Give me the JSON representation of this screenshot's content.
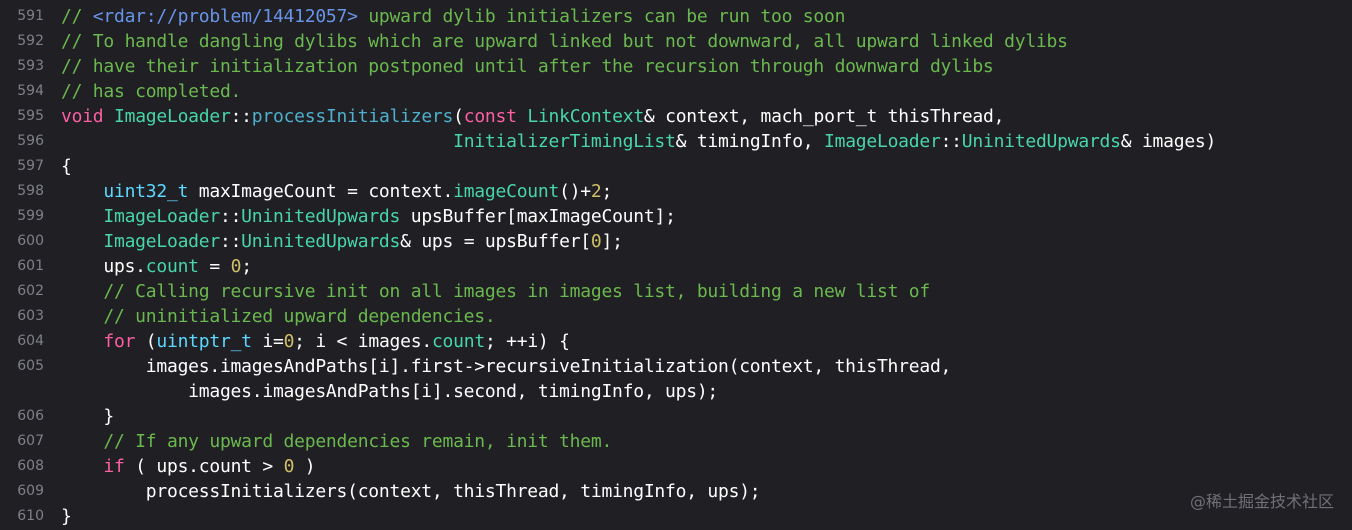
{
  "editor": {
    "lines": [
      {
        "number": "591",
        "segments": [
          {
            "t": "// ",
            "c": "comment"
          },
          {
            "t": "<rdar://problem/14412057>",
            "c": "link"
          },
          {
            "t": " upward dylib initializers can be run too soon",
            "c": "comment"
          }
        ]
      },
      {
        "number": "592",
        "segments": [
          {
            "t": "// To handle dangling dylibs which are upward linked but not downward, all upward linked dylibs",
            "c": "comment"
          }
        ]
      },
      {
        "number": "593",
        "segments": [
          {
            "t": "// have their initialization postponed until after the recursion through downward dylibs",
            "c": "comment"
          }
        ]
      },
      {
        "number": "594",
        "segments": [
          {
            "t": "// has completed.",
            "c": "comment"
          }
        ]
      },
      {
        "number": "595",
        "segments": [
          {
            "t": "void",
            "c": "keyword"
          },
          {
            "t": " ",
            "c": "plain"
          },
          {
            "t": "ImageLoader",
            "c": "class"
          },
          {
            "t": "::",
            "c": "plain"
          },
          {
            "t": "processInitializers",
            "c": "func"
          },
          {
            "t": "(",
            "c": "plain"
          },
          {
            "t": "const",
            "c": "keyword"
          },
          {
            "t": " ",
            "c": "plain"
          },
          {
            "t": "LinkContext",
            "c": "class"
          },
          {
            "t": "& context, mach_port_t thisThread,",
            "c": "plain"
          }
        ]
      },
      {
        "number": "596",
        "segments": [
          {
            "t": "                                     ",
            "c": "plain"
          },
          {
            "t": "InitializerTimingList",
            "c": "class"
          },
          {
            "t": "& timingInfo, ",
            "c": "plain"
          },
          {
            "t": "ImageLoader",
            "c": "class"
          },
          {
            "t": "::",
            "c": "plain"
          },
          {
            "t": "UninitedUpwards",
            "c": "class"
          },
          {
            "t": "& images)",
            "c": "plain"
          }
        ]
      },
      {
        "number": "597",
        "segments": [
          {
            "t": "{",
            "c": "plain"
          }
        ]
      },
      {
        "number": "598",
        "segments": [
          {
            "t": "    ",
            "c": "plain"
          },
          {
            "t": "uint32_t",
            "c": "type"
          },
          {
            "t": " maxImageCount = context.",
            "c": "plain"
          },
          {
            "t": "imageCount",
            "c": "class"
          },
          {
            "t": "()+",
            "c": "plain"
          },
          {
            "t": "2",
            "c": "num"
          },
          {
            "t": ";",
            "c": "plain"
          }
        ]
      },
      {
        "number": "599",
        "segments": [
          {
            "t": "    ",
            "c": "plain"
          },
          {
            "t": "ImageLoader",
            "c": "class"
          },
          {
            "t": "::",
            "c": "plain"
          },
          {
            "t": "UninitedUpwards",
            "c": "class"
          },
          {
            "t": " upsBuffer[maxImageCount];",
            "c": "plain"
          }
        ]
      },
      {
        "number": "600",
        "segments": [
          {
            "t": "    ",
            "c": "plain"
          },
          {
            "t": "ImageLoader",
            "c": "class"
          },
          {
            "t": "::",
            "c": "plain"
          },
          {
            "t": "UninitedUpwards",
            "c": "class"
          },
          {
            "t": "& ups = upsBuffer[",
            "c": "plain"
          },
          {
            "t": "0",
            "c": "num"
          },
          {
            "t": "];",
            "c": "plain"
          }
        ]
      },
      {
        "number": "601",
        "segments": [
          {
            "t": "    ups.",
            "c": "plain"
          },
          {
            "t": "count",
            "c": "class"
          },
          {
            "t": " = ",
            "c": "plain"
          },
          {
            "t": "0",
            "c": "num"
          },
          {
            "t": ";",
            "c": "plain"
          }
        ]
      },
      {
        "number": "602",
        "segments": [
          {
            "t": "    ",
            "c": "plain"
          },
          {
            "t": "// Calling recursive init on all images in images list, building a new list of",
            "c": "comment"
          }
        ]
      },
      {
        "number": "603",
        "segments": [
          {
            "t": "    ",
            "c": "plain"
          },
          {
            "t": "// uninitialized upward dependencies.",
            "c": "comment"
          }
        ]
      },
      {
        "number": "604",
        "segments": [
          {
            "t": "    ",
            "c": "plain"
          },
          {
            "t": "for",
            "c": "keyword"
          },
          {
            "t": " (",
            "c": "plain"
          },
          {
            "t": "uintptr_t",
            "c": "type"
          },
          {
            "t": " i=",
            "c": "plain"
          },
          {
            "t": "0",
            "c": "num"
          },
          {
            "t": "; i < images.",
            "c": "plain"
          },
          {
            "t": "count",
            "c": "class"
          },
          {
            "t": "; ++i) {",
            "c": "plain"
          }
        ]
      },
      {
        "number": "605",
        "segments": [
          {
            "t": "        images.imagesAndPaths[i].first->recursiveInitialization(context, thisThread,",
            "c": "plain"
          }
        ]
      },
      {
        "number": "",
        "segments": [
          {
            "t": "            images.imagesAndPaths[i].second, timingInfo, ups);",
            "c": "plain"
          }
        ]
      },
      {
        "number": "606",
        "segments": [
          {
            "t": "    }",
            "c": "plain"
          }
        ]
      },
      {
        "number": "607",
        "segments": [
          {
            "t": "    ",
            "c": "plain"
          },
          {
            "t": "// If any upward dependencies remain, init them.",
            "c": "comment"
          }
        ]
      },
      {
        "number": "608",
        "segments": [
          {
            "t": "    ",
            "c": "plain"
          },
          {
            "t": "if",
            "c": "keyword"
          },
          {
            "t": " ( ups.count > ",
            "c": "plain"
          },
          {
            "t": "0",
            "c": "num"
          },
          {
            "t": " )",
            "c": "plain"
          }
        ]
      },
      {
        "number": "609",
        "segments": [
          {
            "t": "        processInitializers(context, thisThread, timingInfo, ups);",
            "c": "plain"
          }
        ]
      },
      {
        "number": "610",
        "segments": [
          {
            "t": "}",
            "c": "plain"
          }
        ]
      }
    ]
  },
  "watermark": "@稀土掘金技术社区"
}
